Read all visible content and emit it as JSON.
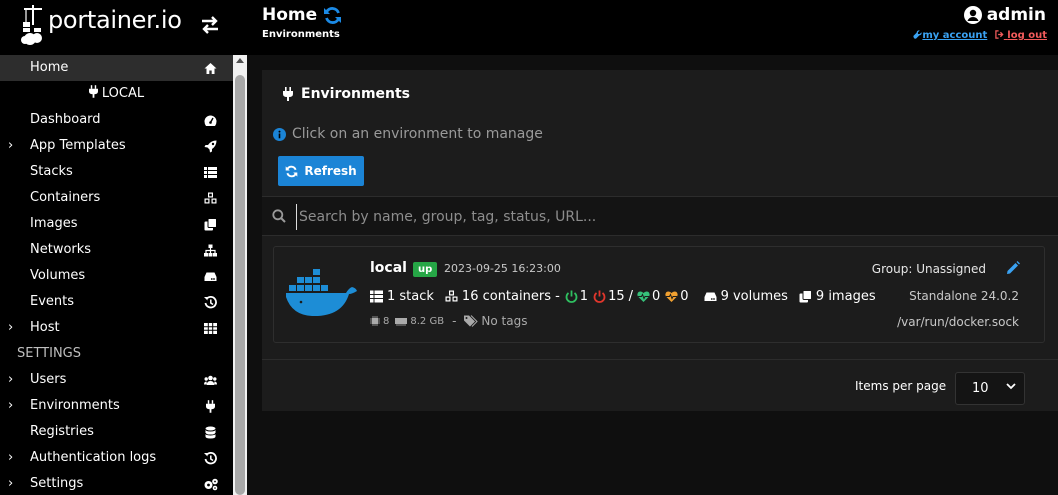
{
  "brand": {
    "name": "portainer.io"
  },
  "sidebar": {
    "items": [
      {
        "label": "Home",
        "icon": "home-icon",
        "active": true
      },
      {
        "label": "LOCAL",
        "icon": "plug-icon",
        "env": true
      },
      {
        "label": "Dashboard",
        "icon": "gauge-icon"
      },
      {
        "label": "App Templates",
        "icon": "rocket-icon",
        "expandable": true
      },
      {
        "label": "Stacks",
        "icon": "list-icon"
      },
      {
        "label": "Containers",
        "icon": "cubes-icon"
      },
      {
        "label": "Images",
        "icon": "clone-icon"
      },
      {
        "label": "Networks",
        "icon": "sitemap-icon"
      },
      {
        "label": "Volumes",
        "icon": "hdd-icon"
      },
      {
        "label": "Events",
        "icon": "history-icon"
      },
      {
        "label": "Host",
        "icon": "grid-icon",
        "expandable": true
      }
    ],
    "settings_title": "SETTINGS",
    "settings_items": [
      {
        "label": "Users",
        "icon": "users-icon",
        "expandable": true
      },
      {
        "label": "Environments",
        "icon": "plug-icon",
        "expandable": true
      },
      {
        "label": "Registries",
        "icon": "database-icon"
      },
      {
        "label": "Authentication logs",
        "icon": "history-icon",
        "expandable": true
      },
      {
        "label": "Settings",
        "icon": "cogs-icon",
        "expandable": true
      }
    ]
  },
  "header": {
    "title": "Home",
    "breadcrumb": "Environments",
    "user": "admin",
    "my_account": "my account",
    "logout": "log out"
  },
  "panel": {
    "title": "Environments",
    "info": "Click on an environment to manage",
    "refresh_label": "Refresh",
    "search_placeholder": "Search by name, group, tag, status, URL..."
  },
  "environment": {
    "name": "local",
    "status": "up",
    "timestamp": "2023-09-25 16:23:00",
    "group": "Group: Unassigned",
    "stacks": "1 stack",
    "containers": "16 containers -",
    "running": "1",
    "stopped": "15",
    "slash": "/",
    "healthy": "0",
    "unhealthy": "0",
    "volumes": "9 volumes",
    "images": "9 images",
    "type": "Standalone 24.0.2",
    "cpu": "8",
    "memory": "8.2 GB",
    "dash": "-",
    "tags": "No tags",
    "socket": "/var/run/docker.sock"
  },
  "pagination": {
    "items_per_page_label": "Items per page",
    "items_per_page": "10"
  },
  "colors": {
    "accent": "#1b84d6",
    "status_up": "#26a646",
    "running": "#2fbf60",
    "stopped": "#e0362c",
    "healthy": "#36c07a",
    "unhealthy": "#f0a030",
    "logout": "#f25b5b",
    "link": "#3aa2f2"
  }
}
